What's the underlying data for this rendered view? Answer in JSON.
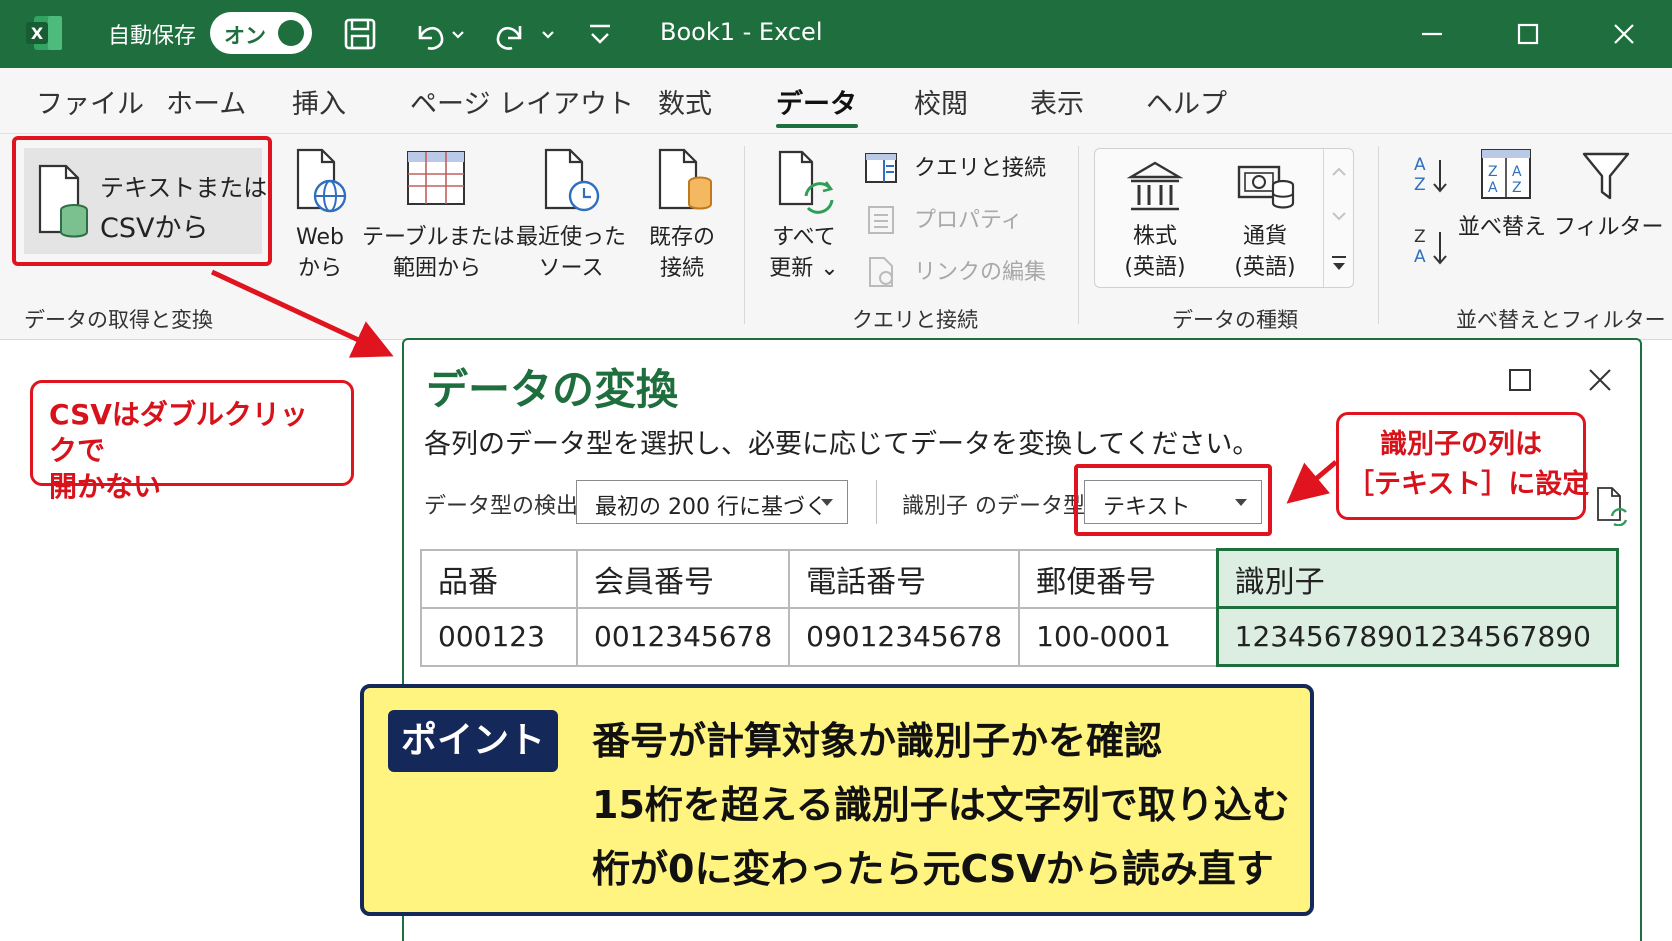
{
  "titlebar": {
    "autosave_label": "自動保存",
    "autosave_state": "オン",
    "window_title": "Book1  -  Excel",
    "accent_color": "#1e6e3e"
  },
  "menu": {
    "tabs": [
      "ファイル",
      "ホーム",
      "挿入",
      "ページ レイアウト",
      "数式",
      "データ",
      "校閲",
      "表示",
      "ヘルプ"
    ],
    "active": "データ"
  },
  "ribbon": {
    "text_csv": {
      "line1": "テキストまたは",
      "line2": "CSVから"
    },
    "web": {
      "line1": "Web",
      "line2": "から"
    },
    "table": {
      "line1": "テーブルまたは",
      "line2": "範囲から"
    },
    "recent": {
      "line1": "最近使った",
      "line2": "ソース"
    },
    "existing": {
      "line1": "既存の",
      "line2": "接続"
    },
    "refresh": {
      "line1": "すべて",
      "line2": "更新 ⌄"
    },
    "queries": "クエリと接続",
    "properties": "プロパティ",
    "edit_links": "リンクの編集",
    "stocks": {
      "line1": "株式",
      "line2": "(英語)"
    },
    "currency": {
      "line1": "通貨",
      "line2": "(英語)"
    },
    "sort": "並べ替え",
    "filter": "フィルター",
    "groups": {
      "get_transform": "データの取得と変換",
      "queries": "クエリと接続",
      "data_types": "データの種類",
      "sort_filter": "並べ替えとフィルター"
    }
  },
  "dialog": {
    "title": "データの変換",
    "description": "各列のデータ型を選択し、必要に応じてデータを変換してください。",
    "detect_label": "データ型の検出",
    "detect_value": "最初の 200 行に基づく",
    "ident_type_label": "識別子 のデータ型",
    "ident_type_value": "テキスト",
    "table": {
      "headers": [
        "品番",
        "会員番号",
        "電話番号",
        "郵便番号",
        "識別子"
      ],
      "row": [
        "000123",
        "0012345678",
        "09012345678",
        "100-0001",
        "12345678901234567890"
      ]
    }
  },
  "callouts": {
    "left": {
      "line1": "CSVはダブルクリックで",
      "line2": "開かない"
    },
    "right": {
      "line1": "識別子の列は",
      "line2": "［テキスト］に設定"
    }
  },
  "point": {
    "badge": "ポイント",
    "lines": [
      "番号が計算対象か識別子かを確認",
      "15桁を超える識別子は文字列で取り込む",
      "桁が0に変わったら元CSVから読み直す"
    ]
  }
}
